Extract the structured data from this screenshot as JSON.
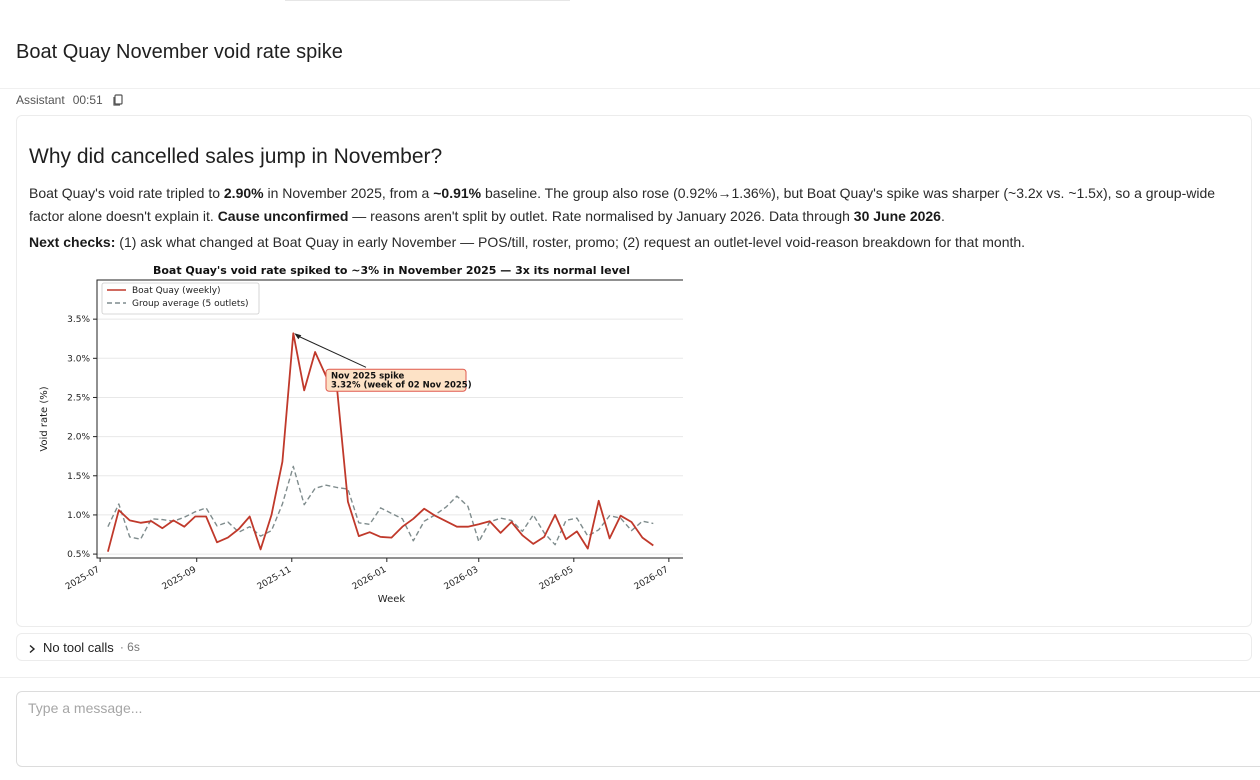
{
  "page": {
    "title": "Boat Quay November void rate spike"
  },
  "message": {
    "author": "Assistant",
    "time": "00:51",
    "heading": "Why did cancelled sales jump in November?",
    "para1": {
      "t1": "Boat Quay's void rate tripled to ",
      "b1": "2.90%",
      "t2": " in November 2025, from a ",
      "b2": "~0.91%",
      "t3": " baseline. The group also rose (0.92%→1.36%), but Boat Quay's spike was sharper (~3.2x vs. ~1.5x), so a group-wide factor alone doesn't explain it. ",
      "b3": "Cause unconfirmed",
      "t4": " — reasons aren't split by outlet. Rate normalised by January 2026. Data through ",
      "b4": "30 June 2026",
      "t5": "."
    },
    "para2": {
      "b1": "Next checks:",
      "t1": " (1) ask what changed at Boat Quay in early November — POS/till, roster, promo; (2) request an outlet-level void-reason breakdown for that month."
    }
  },
  "chart_data": {
    "type": "line",
    "title": "Boat Quay's void rate spiked to ~3% in November 2025 — 3x its normal level",
    "xlabel": "Week",
    "ylabel": "Void rate (%)",
    "ylim": [
      0.45,
      4.0
    ],
    "yticks": [
      0.5,
      1.0,
      1.5,
      2.0,
      2.5,
      3.0,
      3.5
    ],
    "ytick_labels": [
      "0.5%",
      "1.0%",
      "1.5%",
      "2.0%",
      "2.5%",
      "3.0%",
      "3.5%"
    ],
    "xlim": [
      "2025-06-29",
      "2026-07-12"
    ],
    "xticks": [
      "2025-07",
      "2025-09",
      "2025-11",
      "2026-01",
      "2026-03",
      "2026-05",
      "2026-07"
    ],
    "grid": "horizontal",
    "legend_position": "top-left",
    "x": [
      "2025-07-06",
      "2025-07-13",
      "2025-07-20",
      "2025-07-27",
      "2025-08-03",
      "2025-08-10",
      "2025-08-17",
      "2025-08-24",
      "2025-08-31",
      "2025-09-07",
      "2025-09-14",
      "2025-09-21",
      "2025-09-28",
      "2025-10-05",
      "2025-10-12",
      "2025-10-19",
      "2025-10-26",
      "2025-11-02",
      "2025-11-09",
      "2025-11-16",
      "2025-11-23",
      "2025-11-30",
      "2025-12-07",
      "2025-12-14",
      "2025-12-21",
      "2025-12-28",
      "2026-01-04",
      "2026-01-11",
      "2026-01-18",
      "2026-01-25",
      "2026-02-01",
      "2026-02-08",
      "2026-02-15",
      "2026-02-22",
      "2026-03-01",
      "2026-03-08",
      "2026-03-15",
      "2026-03-22",
      "2026-03-29",
      "2026-04-05",
      "2026-04-12",
      "2026-04-19",
      "2026-04-26",
      "2026-05-03",
      "2026-05-10",
      "2026-05-17",
      "2026-05-24",
      "2026-05-31",
      "2026-06-07",
      "2026-06-14",
      "2026-06-21",
      "2026-06-28"
    ],
    "series": [
      {
        "name": "Boat Quay (weekly)",
        "color": "#c0392b",
        "style": "solid",
        "values": [
          0.53,
          1.06,
          0.93,
          0.9,
          0.92,
          0.83,
          0.93,
          0.85,
          0.98,
          0.98,
          0.65,
          0.71,
          0.82,
          0.98,
          0.56,
          1.0,
          1.68,
          3.32,
          2.59,
          3.08,
          2.77,
          2.62,
          1.17,
          0.73,
          0.78,
          0.72,
          0.71,
          0.85,
          0.95,
          1.08,
          0.99,
          0.92,
          0.85,
          0.85,
          0.88,
          0.92,
          0.77,
          0.91,
          0.74,
          0.63,
          0.72,
          1.0,
          0.69,
          0.79,
          0.57,
          1.18,
          0.7,
          0.99,
          0.91,
          0.71,
          0.61
        ]
      },
      {
        "name": "Group average (5 outlets)",
        "color": "#7f8c8d",
        "style": "dashed",
        "values": [
          0.85,
          1.14,
          0.72,
          0.69,
          0.95,
          0.94,
          0.92,
          0.97,
          1.04,
          1.09,
          0.86,
          0.91,
          0.78,
          0.85,
          0.73,
          0.8,
          1.14,
          1.62,
          1.13,
          1.34,
          1.38,
          1.35,
          1.33,
          0.9,
          0.88,
          1.09,
          1.02,
          0.95,
          0.67,
          0.92,
          1.0,
          1.1,
          1.24,
          1.11,
          0.66,
          0.91,
          0.96,
          0.93,
          0.79,
          1.0,
          0.77,
          0.62,
          0.93,
          0.96,
          0.73,
          0.81,
          0.99,
          0.96,
          0.8,
          0.92,
          0.89
        ]
      }
    ],
    "annotation": {
      "line1": "Nov 2025 spike",
      "line2": "3.32% (week of 02 Nov 2025)",
      "x": "2025-11-02",
      "y": 3.32
    }
  },
  "tool_calls": {
    "label": "No tool calls",
    "duration": "· 6s"
  },
  "composer": {
    "placeholder": "Type a message..."
  }
}
